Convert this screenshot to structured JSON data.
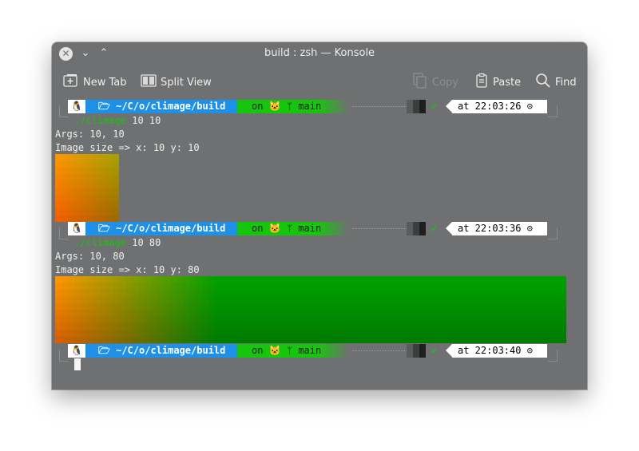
{
  "window": {
    "title": "build : zsh — Konsole"
  },
  "toolbar": {
    "new_tab": "New Tab",
    "split_view": "Split View",
    "copy": "Copy",
    "paste": "Paste",
    "find": "Find"
  },
  "prompts": [
    {
      "dir": "~/C/o/climage/build",
      "git": "on 🐱 ᛘ main",
      "check": "✔",
      "time": "at 22:03:26 ⊙"
    },
    {
      "dir": "~/C/o/climage/build",
      "git": "on 🐱 ᛘ main",
      "check": "✔",
      "time": "at 22:03:36 ⊙"
    },
    {
      "dir": "~/C/o/climage/build",
      "git": "on 🐱 ᛘ main",
      "check": "✔",
      "time": "at 22:03:40 ⊙"
    }
  ],
  "output": {
    "cmd1": {
      "name": "./climage",
      "args": " 10 10"
    },
    "args1": "Args: 10, 10",
    "size1": "Image size => x: 10 y: 10",
    "cmd2": {
      "name": "./climage",
      "args": " 10 80"
    },
    "args2": "Args: 10, 80",
    "size2": "Image size => x: 10 y: 80"
  },
  "images": {
    "small": {
      "cols": 10,
      "rows": 10
    },
    "wide": {
      "cols": 80,
      "rows": 10
    }
  },
  "colors": {
    "orange": "#ff8000",
    "olive": "#a0a000",
    "green": "#00a000",
    "dir_bg": "#1e90e8",
    "git_bg": "#16c60c"
  }
}
